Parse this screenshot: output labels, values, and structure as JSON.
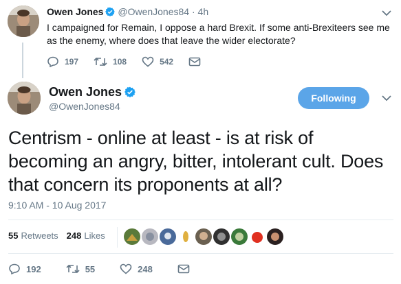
{
  "parent_tweet": {
    "name": "Owen Jones",
    "handle": "@OwenJones84",
    "separator": "·",
    "time": "4h",
    "text": "I campaigned for Remain, I oppose a hard Brexit. If some anti-Brexiteers see me as the enemy, where does that leave the wider electorate?",
    "replies": "197",
    "retweets": "108",
    "likes": "542"
  },
  "main_tweet": {
    "name": "Owen Jones",
    "handle": "@OwenJones84",
    "follow_label": "Following",
    "text": "Centrism - online at least - is at risk of becoming an angry, bitter, intolerant cult. Does that concern its proponents at all?",
    "timestamp": "9:10 AM - 10 Aug 2017",
    "retweet_count": "55",
    "retweet_label": "Retweets",
    "like_count": "248",
    "like_label": "Likes",
    "replies": "192",
    "retweets": "55",
    "likes": "248"
  },
  "colors": {
    "accent": "#5ba5e8",
    "verified": "#1da1f2",
    "muted": "#657786",
    "text": "#14171a"
  },
  "icons": [
    "verified-badge-icon",
    "chevron-down-icon",
    "reply-icon",
    "retweet-icon",
    "like-icon",
    "direct-message-icon"
  ]
}
